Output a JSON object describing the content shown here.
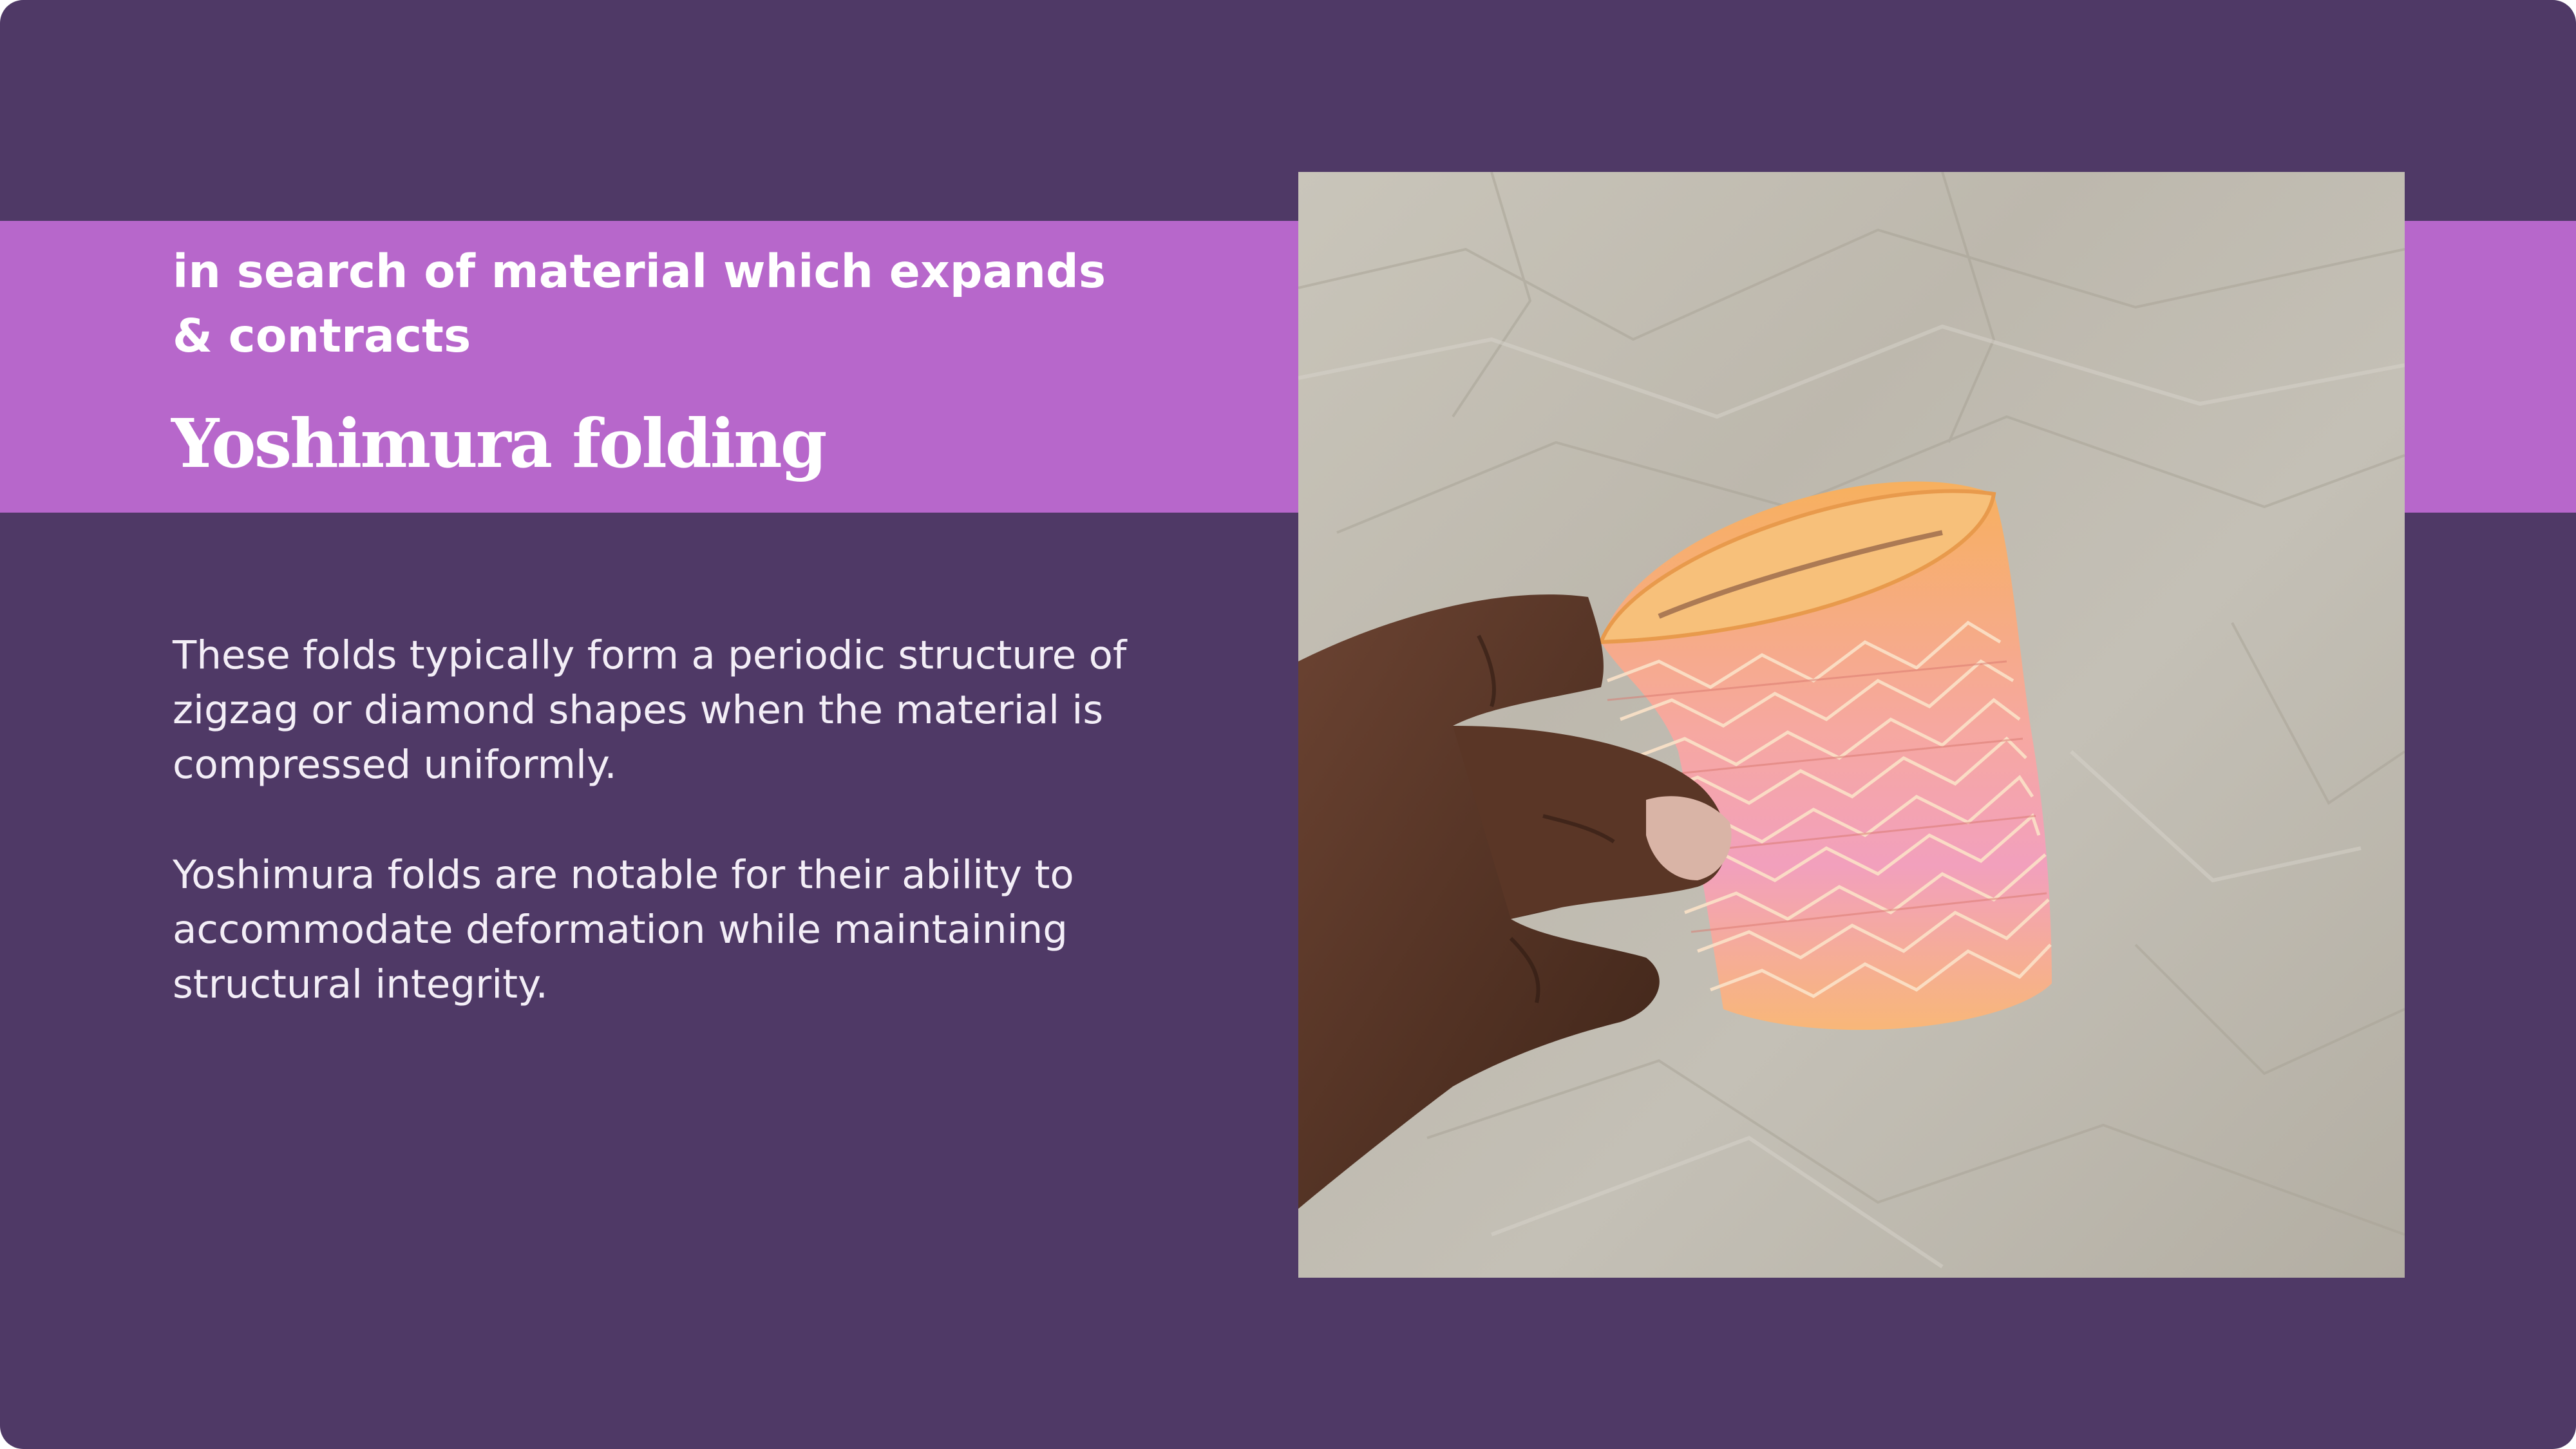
{
  "slide": {
    "subtitle": "in search of material which expands & contracts",
    "title": "Yoshimura folding",
    "paragraphs": [
      "These folds typically form a periodic structure of zigzag or diamond shapes when the material is compressed uniformly.",
      "Yoshimura folds are notable for their ability to accommodate deformation while maintaining structural integrity."
    ]
  },
  "image": {
    "subject": "hand holding orange-pink Yoshimura-folded paper cylinder on crumpled kraft paper"
  },
  "colors": {
    "background": "#4f3966",
    "band": "#b767cb",
    "text": "#ffffff"
  }
}
